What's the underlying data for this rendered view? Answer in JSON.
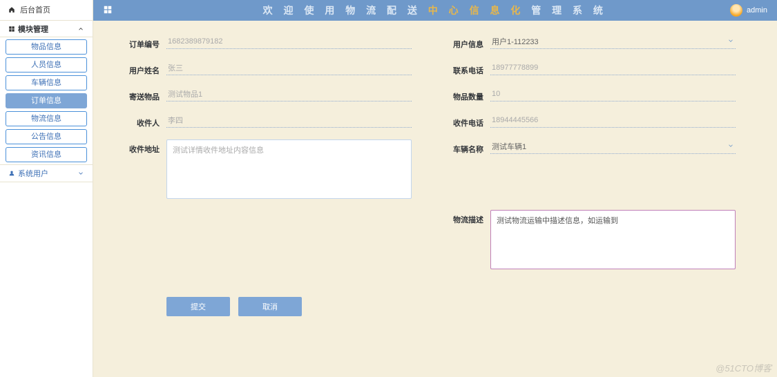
{
  "home_link": "后台首页",
  "sections": {
    "module_mgmt": "模块管理",
    "sys_user": "系统用户"
  },
  "sidebar_items": [
    {
      "id": "goods",
      "label": "物品信息",
      "active": false
    },
    {
      "id": "people",
      "label": "人员信息",
      "active": false
    },
    {
      "id": "vehicle",
      "label": "车辆信息",
      "active": false
    },
    {
      "id": "order",
      "label": "订单信息",
      "active": true
    },
    {
      "id": "logistic",
      "label": "物流信息",
      "active": false
    },
    {
      "id": "notice",
      "label": "公告信息",
      "active": false
    },
    {
      "id": "news",
      "label": "资讯信息",
      "active": false
    }
  ],
  "title_parts": {
    "a": "欢 迎 使 用 物 流 配 送",
    "b": "中 心 信 息 化",
    "c": "管 理",
    "d": "系 统"
  },
  "current_user": "admin",
  "form": {
    "order_no": {
      "label": "订单编号",
      "value": "1682389879182"
    },
    "user_info": {
      "label": "用户信息",
      "value": "用户1-112233"
    },
    "user_name": {
      "label": "用户姓名",
      "value": "张三"
    },
    "phone": {
      "label": "联系电话",
      "value": "18977778899"
    },
    "send_item": {
      "label": "寄送物品",
      "value": "测试物品1"
    },
    "item_qty": {
      "label": "物品数量",
      "value": "10"
    },
    "recipient": {
      "label": "收件人",
      "value": "李四"
    },
    "recv_phone": {
      "label": "收件电话",
      "value": "18944445566"
    },
    "recv_addr": {
      "label": "收件地址",
      "value": "测试详情收件地址内容信息"
    },
    "vehicle": {
      "label": "车辆名称",
      "value": "测试车辆1"
    },
    "logistic_desc": {
      "label": "物流描述",
      "value": "测试物流运输中描述信息，如运输到"
    }
  },
  "buttons": {
    "submit": "提交",
    "cancel": "取消"
  },
  "watermark": "@51CTO博客"
}
